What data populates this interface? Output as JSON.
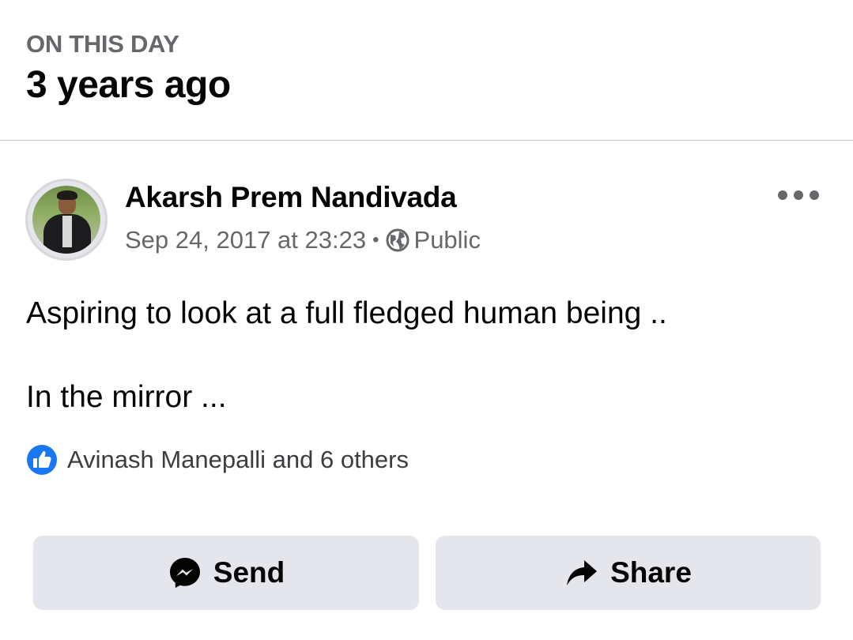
{
  "header": {
    "kicker": "ON THIS DAY",
    "headline": "3 years ago"
  },
  "post": {
    "author": "Akarsh Prem Nandivada",
    "timestamp": "Sep 24, 2017 at 23:23",
    "separator": "•",
    "audience": "Public",
    "audience_icon": "globe-icon",
    "text_line1": "Aspiring to look at a full fledged human being ..",
    "text_line2": "In the mirror ...",
    "reactions_text": "Avinash Manepalli and 6 others",
    "reaction_icon": "like-icon"
  },
  "actions": {
    "send_label": "Send",
    "share_label": "Share"
  },
  "colors": {
    "primary_text": "#050505",
    "secondary_text": "#65676b",
    "button_bg": "#e4e6eb",
    "like_blue": "#1877f2"
  }
}
